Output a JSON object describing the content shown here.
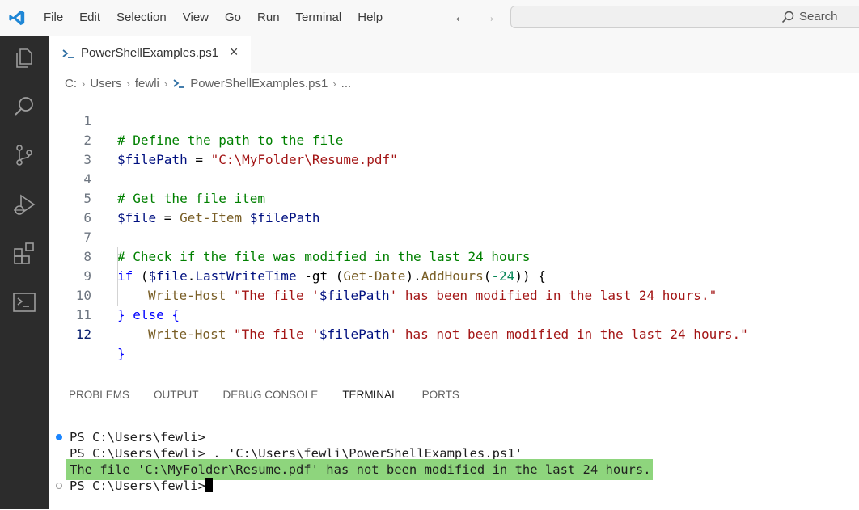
{
  "titlebar": {
    "menu": [
      "File",
      "Edit",
      "Selection",
      "View",
      "Go",
      "Run",
      "Terminal",
      "Help"
    ],
    "search_label": "Search"
  },
  "activity_bar": {
    "icons": [
      "explorer-icon",
      "search-icon",
      "source-control-icon",
      "run-debug-icon",
      "extensions-icon",
      "terminal-icon"
    ]
  },
  "tab": {
    "label": "PowerShellExamples.ps1",
    "close": "×"
  },
  "breadcrumb": {
    "parts": [
      "C:",
      "Users",
      "fewli",
      "PowerShellExamples.ps1",
      "..."
    ]
  },
  "editor": {
    "line_numbers": [
      "1",
      "2",
      "3",
      "4",
      "5",
      "6",
      "7",
      "8",
      "9",
      "10",
      "11",
      "12"
    ],
    "lines": {
      "l1": "# Define the path to the file",
      "l2_var": "$filePath",
      "l2_eq": " = ",
      "l2_str": "\"C:\\MyFolder\\Resume.pdf\"",
      "l4": "# Get the file item",
      "l5_var": "$file",
      "l5_eq": " = ",
      "l5_cmd": "Get-Item",
      "l5_arg": " $filePath",
      "l7": "# Check if the file was modified in the last 24 hours",
      "l8_kw": "if",
      "l8_a": " (",
      "l8_var": "$file",
      "l8_b": ".",
      "l8_prop": "LastWriteTime",
      "l8_c": " -gt (",
      "l8_cmd": "Get-Date",
      "l8_d": ").",
      "l8_meth": "AddHours",
      "l8_e": "(",
      "l8_num": "-24",
      "l8_f": ")) {",
      "l9_cmd": "Write-Host",
      "l9_s1": " \"The file '",
      "l9_var": "$filePath",
      "l9_s2": "' has been modified in the last 24 hours.\"",
      "l10": "} else {",
      "l11_cmd": "Write-Host",
      "l11_s1": " \"The file '",
      "l11_var": "$filePath",
      "l11_s2": "' has not been modified in the last 24 hours.\"",
      "l12": "}"
    }
  },
  "panel": {
    "tabs": [
      "PROBLEMS",
      "OUTPUT",
      "DEBUG CONSOLE",
      "TERMINAL",
      "PORTS"
    ],
    "active_tab": "TERMINAL",
    "terminal_lines": [
      "PS C:\\Users\\fewli>",
      "PS C:\\Users\\fewli> . 'C:\\Users\\fewli\\PowerShellExamples.ps1'",
      "The file 'C:\\MyFolder\\Resume.pdf' has not been modified in the last 24 hours.",
      "PS C:\\Users\\fewli>"
    ],
    "highlight_color": "#8ed57d"
  }
}
